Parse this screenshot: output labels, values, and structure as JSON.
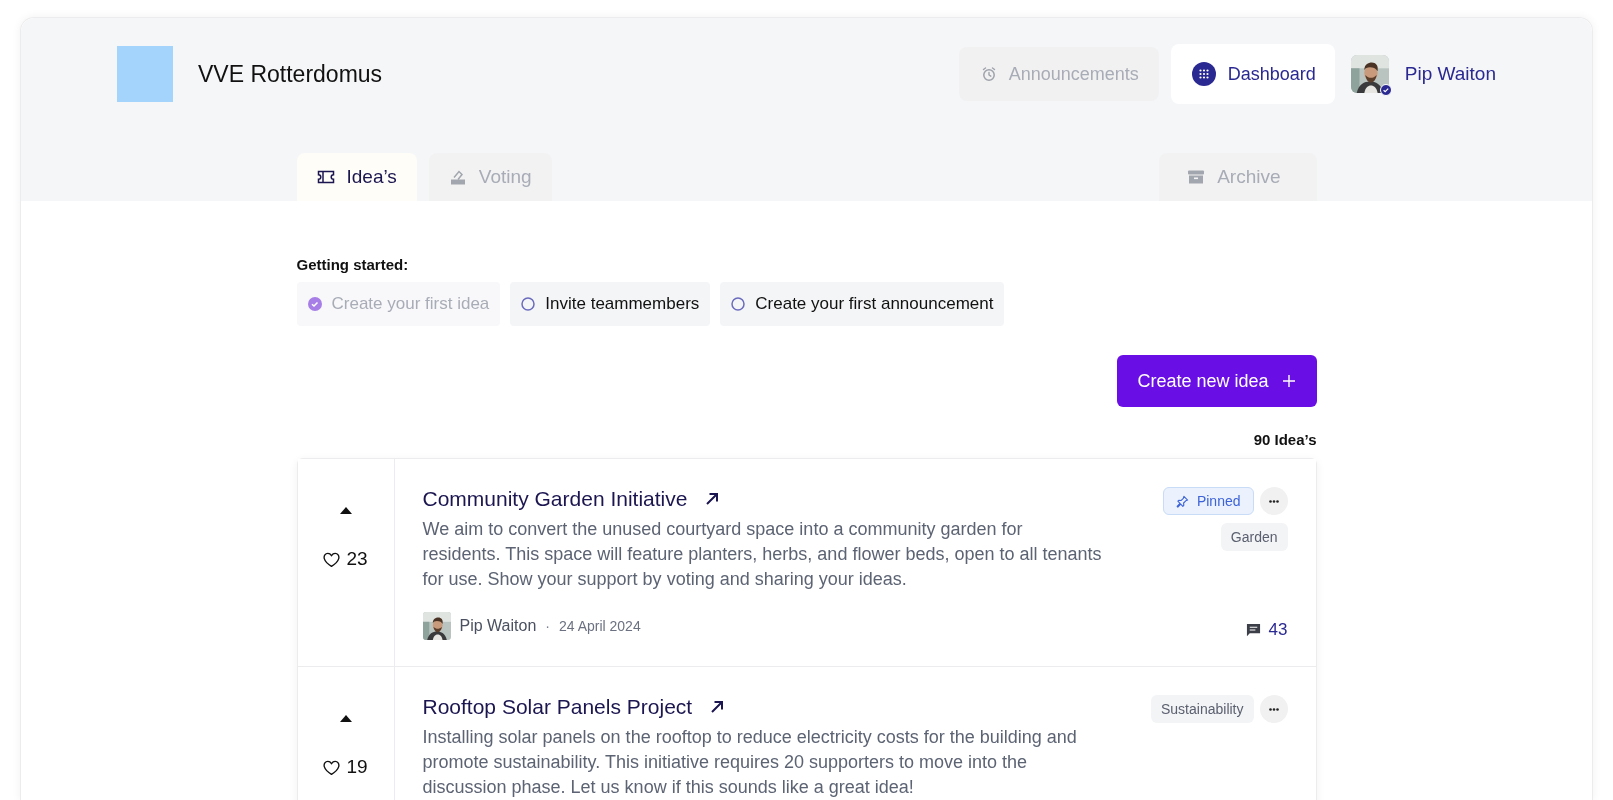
{
  "header": {
    "org_name": "VVE Rotterdomus",
    "nav": [
      {
        "label": "Announcements",
        "kind": "alarm",
        "selected": false
      },
      {
        "label": "Dashboard",
        "kind": "grid",
        "selected": true
      }
    ],
    "user": {
      "name": "Pip Waiton",
      "verified": true
    }
  },
  "tabs": [
    {
      "label": "Idea’s",
      "kind": "ticket",
      "selected": true
    },
    {
      "label": "Voting",
      "kind": "ballot",
      "selected": false
    },
    {
      "label": "Archive",
      "kind": "archive",
      "selected": false
    }
  ],
  "getting_started": {
    "title": "Getting started:",
    "steps": [
      {
        "label": "Create your first idea",
        "done": true
      },
      {
        "label": "Invite teammembers",
        "done": false
      },
      {
        "label": "Create your first announcement",
        "done": false
      }
    ]
  },
  "create_button": {
    "label": "Create new idea"
  },
  "idea_count": "90 Idea’s",
  "ideas": [
    {
      "votes": "23",
      "title": "Community Garden Initiative",
      "body": "We aim to convert the unused courtyard space into a community garden for residents. This space will feature planters, herbs, and flower beds, open to all tenants for use. Show your support by voting and sharing your ideas.",
      "pinned": true,
      "pin_label": "Pinned",
      "tag": "Garden",
      "author": "Pip Waiton",
      "separator": "·",
      "date": "24 April 2024",
      "comments": "43"
    },
    {
      "votes": "19",
      "title": "Rooftop Solar Panels Project",
      "body": "Installing solar panels on the rooftop to reduce electricity costs for the building and promote sustainability. This initiative requires 20 supporters to move into the discussion phase. Let us know if this sounds like a great idea!",
      "pinned": false,
      "tag": "Sustainability"
    }
  ]
}
